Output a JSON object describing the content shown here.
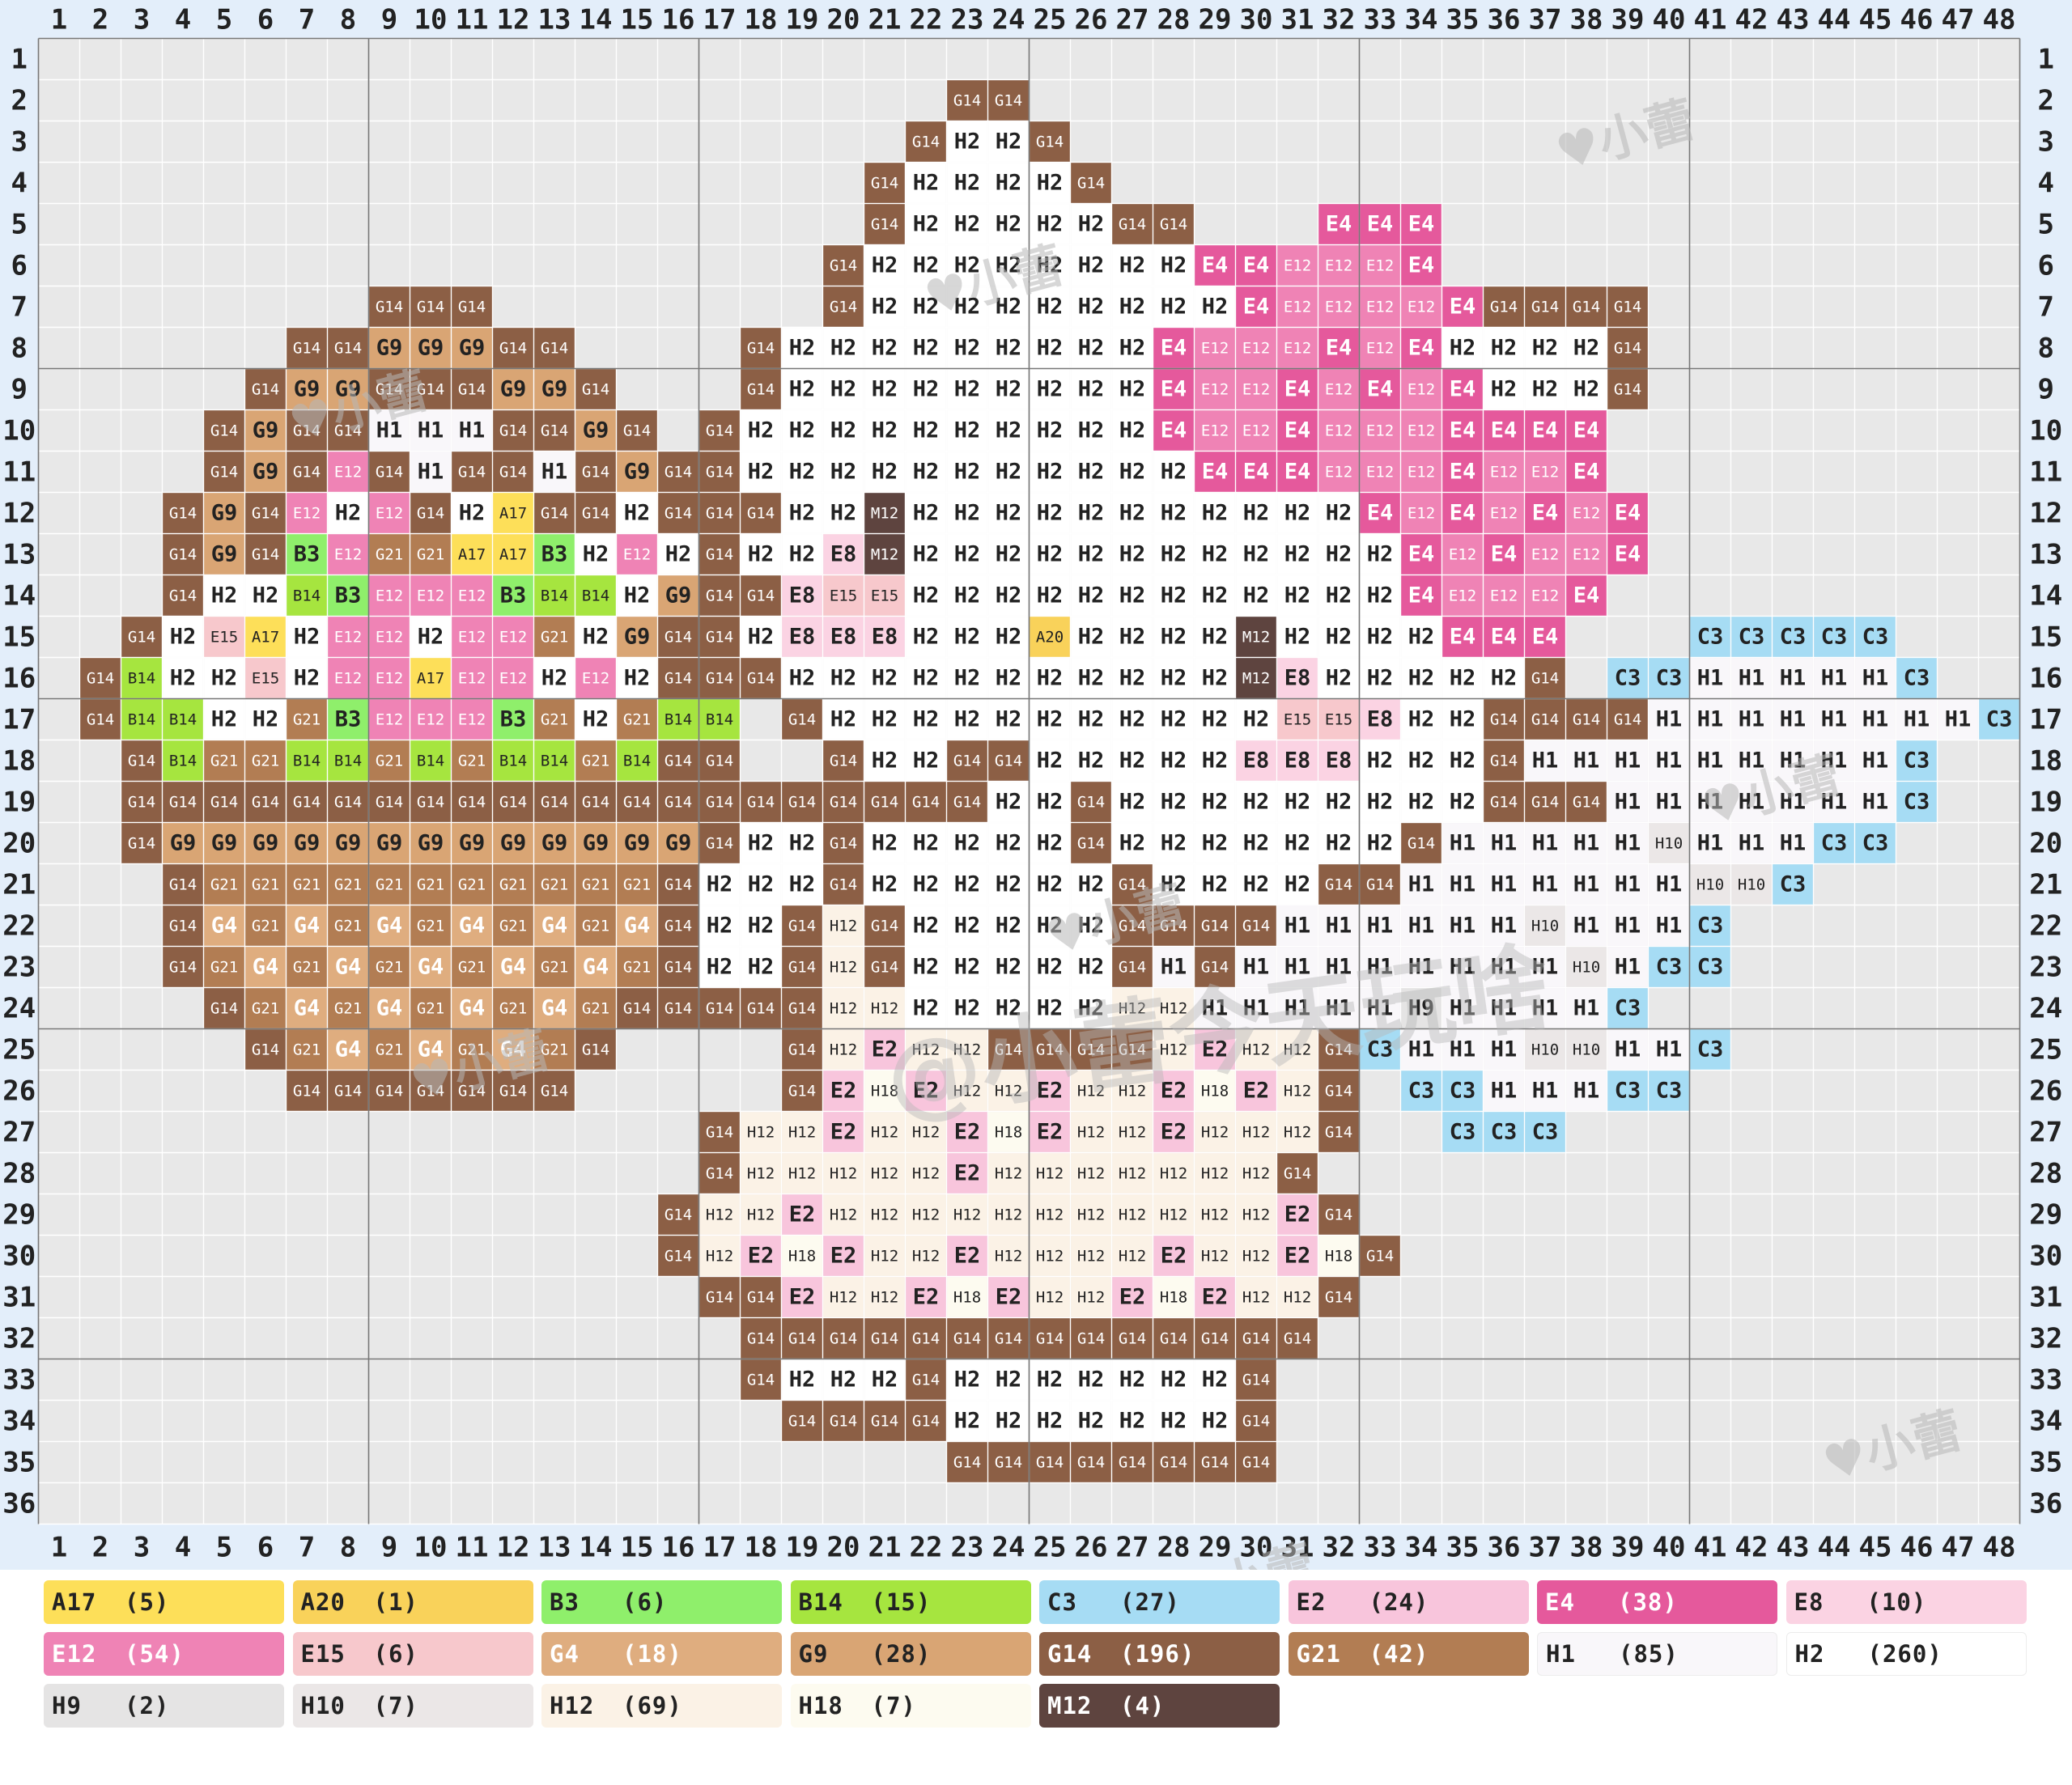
{
  "grid": {
    "columns": 48,
    "rows": 36,
    "column_numbers": [
      "1",
      "2",
      "3",
      "4",
      "5",
      "6",
      "7",
      "8",
      "9",
      "10",
      "11",
      "12",
      "13",
      "14",
      "15",
      "16",
      "17",
      "18",
      "19",
      "20",
      "21",
      "22",
      "23",
      "24",
      "25",
      "26",
      "27",
      "28",
      "29",
      "30",
      "31",
      "32",
      "33",
      "34",
      "35",
      "36",
      "37",
      "38",
      "39",
      "40",
      "41",
      "42",
      "43",
      "44",
      "45",
      "46",
      "47",
      "48"
    ],
    "row_numbers": [
      "1",
      "2",
      "3",
      "4",
      "5",
      "6",
      "7",
      "8",
      "9",
      "10",
      "11",
      "12",
      "13",
      "14",
      "15",
      "16",
      "17",
      "18",
      "19",
      "20",
      "21",
      "22",
      "23",
      "24",
      "25",
      "26",
      "27",
      "28",
      "29",
      "30",
      "31",
      "32",
      "33",
      "34",
      "35",
      "36"
    ],
    "rows_cells": [
      "",
      "G14@23 G14",
      "G14@22 H2 H2 G14",
      "G14@21 H2 H2 H2 H2 G14",
      "G14@21 H2 H2 H2 H2 H2 G14 G14 _ _ _ E4 E4 E4",
      "G14@20 H2 H2 H2 H2 H2 H2 H2 H2 E4 E4 E12 E12 E12 E4",
      "G14@9 G14 G14 _ _ _ _ _ _ _ _ G14 H2 H2 H2 H2 H2 H2 H2 H2 H2 E4 E12 E12 E12 E12 E4 G14 G14 G14 G14",
      "G14@7 G14 G9 G9 G9 G14 G14 _ _ _ _ G14 H2 H2 H2 H2 H2 H2 H2 H2 H2 E4 E12 E12 E12 E4 E12 E4 H2 H2 H2 H2 G14",
      "G14@6 G9 G9 G14 G14 G14 G9 G9 G14 _ _ _ G14 H2 H2 H2 H2 H2 H2 H2 H2 H2 E4 E12 E12 E4 E12 E4 E12 E4 H2 H2 H2 G14",
      "G14@5 G9 G14 G14 H1 H1 H1 G14 G14 G9 G14 _ G14 H2 H2 H2 H2 H2 H2 H2 H2 H2 H2 E4 E12 E12 E4 E12 E12 E12 E4 E4 E4 E4",
      "G14@5 G9 G14 E12 G14 H1 G14 G14 H1 G14 G9 G14 G14 H2 H2 H2 H2 H2 H2 H2 H2 H2 H2 H2 E4 E4 E4 E12 E12 E12 E4 E12 E12 E4",
      "G14@4 G9 G14 E12 H2 E12 G14 H2 A17 G14 G14 H2 G14 G14 G14 H2 H2 M12 H2 H2 H2 H2 H2 H2 H2 H2 H2 H2 H2 E4 E12 E4 E12 E4 E12 E4",
      "G14@4 G9 G14 B3 E12 G21 G21 A17 A17 B3 H2 E12 H2 G14 H2 H2 E8 M12 H2 H2 H2 H2 H2 H2 H2 H2 H2 H2 H2 H2 E4 E12 E4 E12 E12 E4",
      "G14@4 H2 H2 B14 B3 E12 E12 E12 B3 B14 B14 H2 G9 G14 G14 E8 E15 E15 H2 H2 H2 H2 H2 H2 H2 H2 H2 H2 H2 H2 E4 E12 E12 E12 E4",
      "G14@3 H2 E15 A17 H2 E12 E12 H2 E12 E12 G21 H2 G9 G14 G14 H2 E8 E8 E8 H2 H2 H2 A20 H2 H2 H2 H2 M12 H2 H2 H2 H2 E4 E4 E4 _ _ _ C3 C3 C3 C3 C3",
      "G14@2 B14 H2 H2 E15 H2 E12 E12 A17 E12 E12 H2 E12 H2 G14 G14 G14 H2 H2 H2 H2 H2 H2 H2 H2 H2 H2 H2 M12 E8 H2 H2 H2 H2 H2 G14 _ C3 C3 H1 H1 H1 H1 H1 C3",
      "G14@2 B14 B14 H2 H2 G21 B3 E12 E12 E12 B3 G21 H2 G21 B14 B14 _ G14 H2 H2 H2 H2 H2 H2 H2 H2 H2 H2 H2 E15 E15 E8 H2 H2 G14 G14 G14 G14 H1 H1 H1 H1 H1 H1 H1 H1 C3",
      "G14@3 B14 G21 G21 B14 B14 G21 B14 G21 B14 B14 G21 B14 G14 G14 _ _ G14 H2 H2 G14 G14 H2 H2 H2 H2 H2 E8 E8 E8 H2 H2 H2 G14 H1 H1 H1 H1 H1 H1 H1 H1 H1 C3",
      "G14@3 G14 G14 G14 G14 G14 G14 G14 G14 G14 G14 G14 G14 G14 G14 G14 G14 G14 G14 G14 G14 H2 H2 G14 H2 H2 H2 H2 H2 H2 H2 H2 H2 G14 G14 G14 H1 H1 H1 H1 H1 H1 H1 C3",
      "G14@3 G9 G9 G9 G9 G9 G9 G9 G9 G9 G9 G9 G9 G9 G14 H2 H2 G14 H2 H2 H2 H2 H2 G14 H2 H2 H2 H2 H2 H2 H2 G14 H1 H1 H1 H1 H1 H10 H1 H1 H1 C3 C3",
      "G14@4 G21 G21 G21 G21 G21 G21 G21 G21 G21 G21 G21 G14 H2 H2 H2 G14 H2 H2 H2 H2 H2 H2 G14 H2 H2 H2 H2 G14 G14 H1 H1 H1 H1 H1 H1 H1 H10 H10 C3",
      "G14@4 G4 G21 G4 G21 G4 G21 G4 G21 G4 G21 G4 G14 H2 H2 G14 H12 G14 H2 H2 H2 H2 H2 G14 G14 G14 G14 H1 H1 H1 H1 H1 H1 H10 H1 H1 H1 C3",
      "G14@4 G21 G4 G21 G4 G21 G4 G21 G4 G21 G4 G21 G14 H2 H2 G14 H12 G14 H2 H2 H2 H2 H2 G14 H1 G14 H1 H1 H1 H1 H1 H1 H1 H1 H10 H1 C3 C3",
      "G14@5 G21 G4 G21 G4 G21 G4 G21 G4 G21 G14 G14 G14 G14 G14 H12 H12 H2 H2 H2 H2 H2 H12 H12 H1 H1 H1 H1 H1 H9 H1 H1 H1 H1 C3",
      "G14@6 G21 G4 G21 G4 G21 G4 G21 G14 _ _ _ _ G14 H12 E2 H12 H12 G14 G14 G14 G14 H12 E2 H12 H12 G14 C3 H1 H1 H1 H10 H10 H1 H1 C3",
      "G14@7 G14 G14 G14 G14 G14 G14 _ _ _ _ _ G14 E2 H18 E2 H12 H12 E2 H12 H12 E2 H18 E2 H12 G14 _ C3 C3 H1 H1 H1 C3 C3",
      "G14@17 H12 H12 E2 H12 H12 E2 H18 E2 H12 H12 E2 H12 H12 H12 G14 _ _ C3 C3 C3",
      "G14@17 H12 H12 H12 H12 H12 E2 H12 H12 H12 H12 H12 H12 H12 G14",
      "G14@16 H12 H12 E2 H12 H12 H12 H12 H12 H12 H12 H12 H12 H12 H12 E2 G14",
      "G14@16 H12 E2 H18 E2 H12 H12 E2 H12 H12 H12 H12 E2 H12 H12 E2 H18 G14",
      "G14@17 G14 E2 H12 H12 E2 H18 E2 H12 H12 E2 H18 E2 H12 H12 G14",
      "G14@18 G14 G14 G14 G14 G14 G14 G14 G14 G14 G14 G14 G14 G14",
      "G14@18 H2 H2 H2 G14 H2 H2 H2 H2 H2 H2 H2 G14",
      "G14@19 G14 G14 G14 H2 H2 H2 H2 H2 H2 H2 G14",
      "G14@23 G14 G14 G14 G14 G14 G14 G14",
      ""
    ]
  },
  "palette": {
    "A17": {
      "bg": "#fddf59",
      "fg": "#222222"
    },
    "A20": {
      "bg": "#f9d25a",
      "fg": "#222222"
    },
    "B3": {
      "bg": "#8fef6b",
      "fg": "#222222"
    },
    "B14": {
      "bg": "#a6e53f",
      "fg": "#222222"
    },
    "C3": {
      "bg": "#a6dcf4",
      "fg": "#222222"
    },
    "E2": {
      "bg": "#f8c5dc",
      "fg": "#222222"
    },
    "E4": {
      "bg": "#e5599c",
      "fg": "#ffffff"
    },
    "E8": {
      "bg": "#fbd3e3",
      "fg": "#222222"
    },
    "E12": {
      "bg": "#ef83b5",
      "fg": "#ffffff"
    },
    "E15": {
      "bg": "#f7c8cc",
      "fg": "#222222"
    },
    "G4": {
      "bg": "#dfad7f",
      "fg": "#ffffff"
    },
    "G9": {
      "bg": "#d9a574",
      "fg": "#222222"
    },
    "G14": {
      "bg": "#8c5f45",
      "fg": "#ffffff"
    },
    "G21": {
      "bg": "#b27d53",
      "fg": "#ffffff"
    },
    "H1": {
      "bg": "#f9f7fa",
      "fg": "#222222"
    },
    "H2": {
      "bg": "#ffffff",
      "fg": "#222222"
    },
    "H9": {
      "bg": "#e5e4e4",
      "fg": "#222222"
    },
    "H10": {
      "bg": "#ebe7e7",
      "fg": "#222222"
    },
    "H12": {
      "bg": "#fbf2e6",
      "fg": "#222222"
    },
    "H18": {
      "bg": "#fdfbf0",
      "fg": "#222222"
    },
    "M12": {
      "bg": "#5e443f",
      "fg": "#ffffff"
    }
  },
  "legend": [
    {
      "code": "A17",
      "count": "(5)"
    },
    {
      "code": "A20",
      "count": "(1)"
    },
    {
      "code": "B3",
      "count": "(6)"
    },
    {
      "code": "B14",
      "count": "(15)"
    },
    {
      "code": "C3",
      "count": "(27)"
    },
    {
      "code": "E2",
      "count": "(24)"
    },
    {
      "code": "E4",
      "count": "(38)"
    },
    {
      "code": "E8",
      "count": "(10)"
    },
    {
      "code": "E12",
      "count": "(54)"
    },
    {
      "code": "E15",
      "count": "(6)"
    },
    {
      "code": "G4",
      "count": "(18)"
    },
    {
      "code": "G9",
      "count": "(28)"
    },
    {
      "code": "G14",
      "count": "(196)"
    },
    {
      "code": "G21",
      "count": "(42)"
    },
    {
      "code": "H1",
      "count": "(85)"
    },
    {
      "code": "H2",
      "count": "(260)"
    },
    {
      "code": "H9",
      "count": "(2)"
    },
    {
      "code": "H10",
      "count": "(7)"
    },
    {
      "code": "H12",
      "count": "(69)"
    },
    {
      "code": "H18",
      "count": "(7)"
    },
    {
      "code": "M12",
      "count": "(4)"
    }
  ],
  "watermark": {
    "main_text": "@小蕾今天玩啥",
    "small_text": "♥小蕾"
  }
}
